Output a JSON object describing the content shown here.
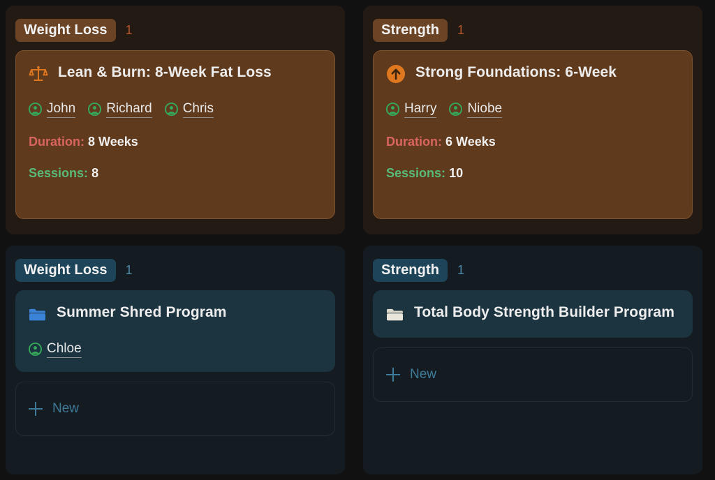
{
  "board": {
    "columns": [
      {
        "id": "weight-loss-warm",
        "theme": "warm",
        "badge_label": "Weight Loss",
        "badge_color": "#6b4425",
        "count": "1",
        "count_color": "#b5552c",
        "panel_color": "#241a14",
        "cards": [
          {
            "icon": "scales-icon",
            "icon_color": "#e07820",
            "title": "Lean & Burn: 8-Week Fat Loss",
            "assignees": [
              "John",
              "Richard",
              "Chris"
            ],
            "meta": [
              {
                "label": "Duration:",
                "value": "8",
                "unit": "Weeks",
                "label_color": "#d9655e"
              },
              {
                "label": "Sessions:",
                "value": "8",
                "unit": "",
                "label_color": "#58b978"
              }
            ]
          }
        ],
        "new_button": null
      },
      {
        "id": "strength-warm",
        "theme": "warm",
        "badge_label": "Strength",
        "badge_color": "#6b4425",
        "count": "1",
        "count_color": "#b5552c",
        "panel_color": "#241a14",
        "cards": [
          {
            "icon": "arrow-up-circle-icon",
            "icon_color": "#e07820",
            "title": "Strong Foundations: 6-Week",
            "assignees": [
              "Harry",
              "Niobe"
            ],
            "meta": [
              {
                "label": "Duration:",
                "value": "6",
                "unit": "Weeks",
                "label_color": "#d9655e"
              },
              {
                "label": "Sessions:",
                "value": "10",
                "unit": "",
                "label_color": "#58b978"
              }
            ]
          }
        ],
        "new_button": null
      },
      {
        "id": "weight-loss-cool",
        "theme": "cool",
        "badge_label": "Weight Loss",
        "badge_color": "#1d4458",
        "count": "1",
        "count_color": "#4e89a8",
        "panel_color": "#151c21",
        "cards": [
          {
            "icon": "folder-icon-blue",
            "icon_color": "#3b82d9",
            "title": "Summer Shred Program",
            "assignees": [
              "Chloe"
            ],
            "meta": []
          }
        ],
        "new_button": {
          "label": "New",
          "icon": "plus-icon",
          "color": "#3e7a99"
        }
      },
      {
        "id": "strength-cool",
        "theme": "cool",
        "badge_label": "Strength",
        "badge_color": "#1d4458",
        "count": "1",
        "count_color": "#4e89a8",
        "panel_color": "#151c21",
        "cards": [
          {
            "icon": "folder-icon-cream",
            "icon_color": "#e6e2d6",
            "title": "Total Body Strength Builder Program",
            "assignees": [],
            "meta": []
          }
        ],
        "new_button": {
          "label": "New",
          "icon": "plus-icon",
          "color": "#3e7a99"
        }
      }
    ]
  }
}
